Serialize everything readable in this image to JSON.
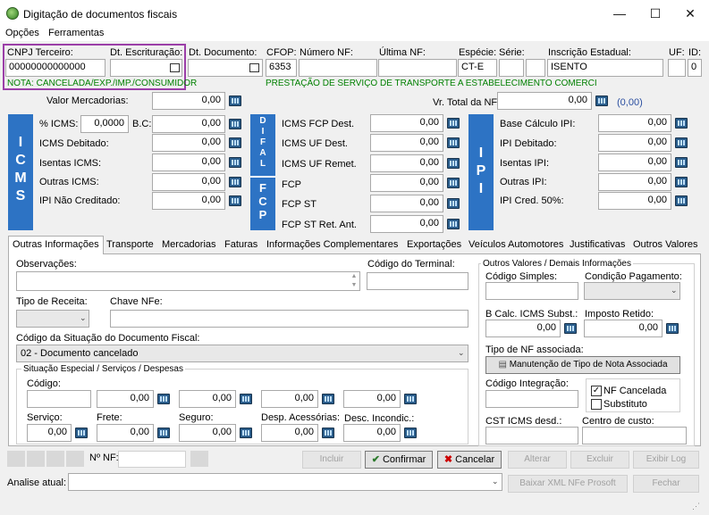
{
  "window": {
    "title": "Digitação de documentos fiscais",
    "minimize": "—",
    "maximize": "☐",
    "close": "✕"
  },
  "menu": [
    "Opções",
    "Ferramentas"
  ],
  "header": {
    "cnpj_label": "CNPJ Terceiro:",
    "cnpj_value": "00000000000000",
    "dt_escrit_label": "Dt. Escrituração:",
    "dt_doc_label": "Dt. Documento:",
    "cfop_label": "CFOP:",
    "cfop_value": "6353",
    "numero_nf_label": "Número NF:",
    "ultima_nf_label": "Última NF:",
    "especie_label": "Espécie:",
    "especie_value": "CT-E",
    "serie_label": "Série:",
    "ie_label": "Inscrição Estadual:",
    "ie_value": "ISENTO",
    "uf_label": "UF:",
    "id_label": "ID:",
    "id_value": "0",
    "nota_text": "NOTA: CANCELADA/EXP./IMP./CONSUMIDOR",
    "cfop_desc": "PRESTAÇÃO DE SERVIÇO DE TRANSPORTE A ESTABELECIMENTO COMERCI"
  },
  "valores": {
    "mercadorias_label": "Valor Mercadorias:",
    "mercadorias_value": "0,00",
    "total_label": "Vr. Total da NF:",
    "total_value": "0,00",
    "total_extra": "(0,00)"
  },
  "icms": {
    "side": "ICMS",
    "perc_label": "% ICMS:",
    "perc_value": "0,0000",
    "bc_label": "B.C:",
    "bc_value": "0,00",
    "rows": [
      {
        "label": "ICMS Debitado:",
        "value": "0,00"
      },
      {
        "label": "Isentas ICMS:",
        "value": "0,00"
      },
      {
        "label": "Outras ICMS:",
        "value": "0,00"
      },
      {
        "label": "IPI Não Creditado:",
        "value": "0,00"
      }
    ]
  },
  "difal": {
    "side": "DIFAL",
    "rows": [
      {
        "label": "ICMS FCP Dest.",
        "value": "0,00"
      },
      {
        "label": "ICMS UF Dest.",
        "value": "0,00"
      },
      {
        "label": "ICMS UF Remet.",
        "value": "0,00"
      }
    ]
  },
  "fcp": {
    "side": "FCP",
    "rows": [
      {
        "label": "FCP",
        "value": "0,00"
      },
      {
        "label": "FCP ST",
        "value": "0,00"
      },
      {
        "label": "FCP ST Ret. Ant.",
        "value": "0,00"
      }
    ]
  },
  "ipi": {
    "side": "IPI",
    "rows": [
      {
        "label": "Base Cálculo IPI:",
        "value": "0,00"
      },
      {
        "label": "IPI Debitado:",
        "value": "0,00"
      },
      {
        "label": "Isentas IPI:",
        "value": "0,00"
      },
      {
        "label": "Outras IPI:",
        "value": "0,00"
      },
      {
        "label": "IPI Cred. 50%:",
        "value": "0,00"
      }
    ]
  },
  "tabs": [
    "Outras Informações",
    "Transporte",
    "Mercadorias",
    "Faturas",
    "Informações Complementares",
    "Exportações",
    "Veículos Automotores",
    "Justificativas",
    "Outros Valores"
  ],
  "outras": {
    "obs_label": "Observações:",
    "terminal_label": "Código do Terminal:",
    "tipo_receita_label": "Tipo de Receita:",
    "chave_label": "Chave NFe:",
    "situacao_label": "Código da Situação do Documento Fiscal:",
    "situacao_value": "02 - Documento cancelado",
    "especial_legend": "Situação Especial / Serviços / Despesas",
    "codigo_label": "Código:",
    "esp_values": [
      "0,00",
      "0,00",
      "0,00",
      "0,00"
    ],
    "servico_label": "Serviço:",
    "servico_value": "0,00",
    "frete_label": "Frete:",
    "frete_value": "0,00",
    "seguro_label": "Seguro:",
    "seguro_value": "0,00",
    "desp_label": "Desp. Acessórias:",
    "desp_value": "0,00",
    "desc_label": "Desc. Incondic.:",
    "desc_value": "0,00",
    "ov_legend": "Outros Valores / Demais Informações",
    "cod_simples_label": "Código Simples:",
    "cond_pag_label": "Condição Pagamento:",
    "bc_st_label": "B Calc. ICMS Subst.:",
    "bc_st_value": "0,00",
    "imp_ret_label": "Imposto Retido:",
    "imp_ret_value": "0,00",
    "tipo_nf_label": "Tipo de NF associada:",
    "manut_btn": "Manutenção de Tipo de Nota Associada",
    "cod_integ_label": "Código Integração:",
    "nf_cancelada": "NF Cancelada",
    "substituto": "Substituto",
    "cst_label": "CST ICMS desd.:",
    "centro_label": "Centro de custo:"
  },
  "bottom": {
    "nnf_label": "Nº NF:",
    "incluir": "Incluir",
    "confirmar": "Confirmar",
    "cancelar": "Cancelar",
    "alterar": "Alterar",
    "excluir": "Excluir",
    "exibir_log": "Exibir Log",
    "analise_label": "Analise atual:",
    "baixar": "Baixar XML NFe Prosoft",
    "fechar": "Fechar"
  }
}
